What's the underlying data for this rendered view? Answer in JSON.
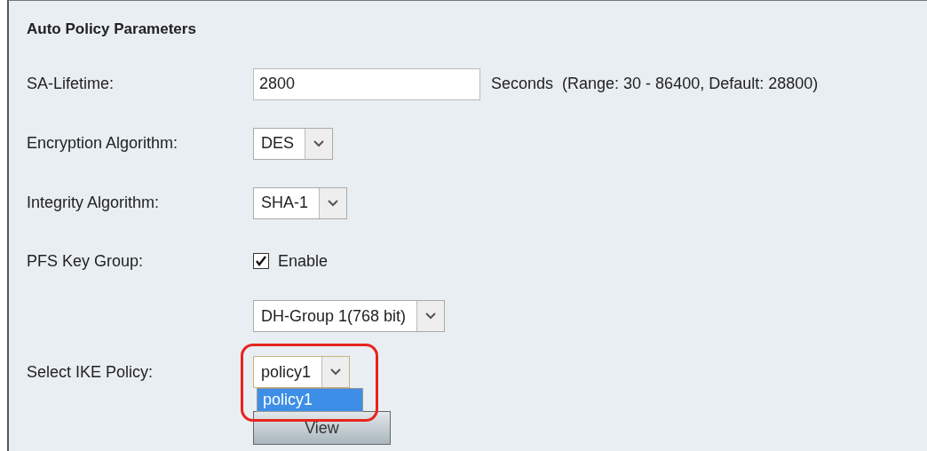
{
  "panel": {
    "title": "Auto Policy Parameters"
  },
  "rows": [
    {
      "kind": "text",
      "label": "SA-Lifetime:",
      "value": "2800",
      "hint": "Seconds  (Range: 30 - 86400, Default: 28800)"
    },
    {
      "kind": "select",
      "label": "Encryption Algorithm:",
      "value": "DES"
    },
    {
      "kind": "select",
      "label": "Integrity Algorithm:",
      "value": "SHA-1"
    },
    {
      "kind": "checkbox",
      "label": "PFS Key Group:",
      "text": "Enable",
      "checked": true
    },
    {
      "kind": "select",
      "value": "DH-Group 1(768 bit)"
    },
    {
      "kind": "select",
      "label": "Select IKE Policy:",
      "value": "policy1",
      "expanded": true,
      "highlighted": true,
      "options": [
        {
          "label": "policy1",
          "selected": true
        }
      ]
    }
  ],
  "button": "View"
}
